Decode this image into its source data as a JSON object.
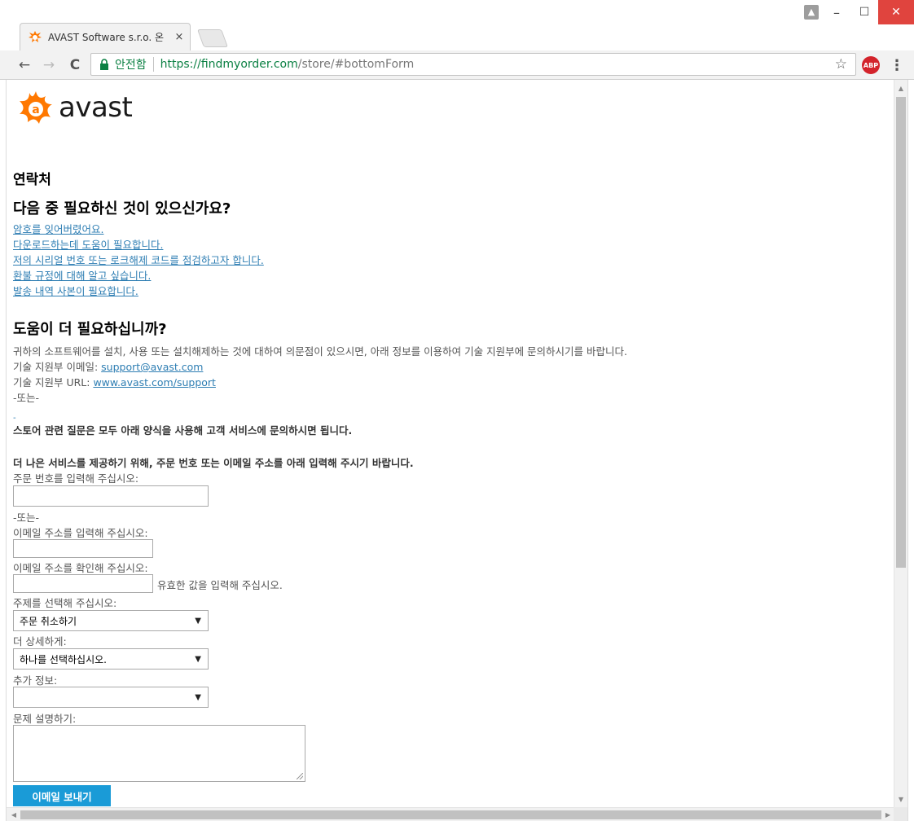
{
  "browser": {
    "tab_title": "AVAST Software s.r.o. 온",
    "tab_close": "×",
    "secure_label": "안전함",
    "url_host": "https://findmyorder.com",
    "url_path": "/store/#bottomForm",
    "star_icon": "☆",
    "abp_label": "ABP",
    "menu_icon": "⋮",
    "controls": {
      "user": "▲",
      "minimize": "–",
      "maximize": "☐",
      "close": "✕"
    },
    "nav": {
      "back": "←",
      "forward": "→",
      "reload": "C"
    }
  },
  "logo": {
    "wordmark": "avast",
    "color": "#ff7800"
  },
  "page": {
    "contact_heading": "연락처",
    "need_heading": "다음 중 필요하신 것이 있으신가요?",
    "links": [
      " 암호를 잊어버렸어요.",
      "다운로드하는데 도움이 필요합니다.",
      "저의 시리얼 번호 또는 로크해제 코드를 점검하고자 합니다.",
      "환불 규정에 대해 알고 싶습니다.",
      "발송 내역 사본이 필요합니다."
    ],
    "more_heading": "도움이 더 필요하십니까?",
    "support_text": "귀하의 소프트웨어를 설치, 사용 또는 설치해제하는 것에 대하여 의문점이 있으시면, 아래 정보를 이용하여 기술 지원부에 문의하시기를 바랍니다.",
    "email_label": "기술 지원부 이메일: ",
    "email_link": "support@avast.com",
    "url_label": "기술 지원부 URL: ",
    "url_link": "www.avast.com/support",
    "or_text": "-또는-",
    "tiny_link": "-",
    "store_note": "스토어 관련 질문은 모두 아래 양식을 사용해 고객 서비스에 문의하시면 됩니다.",
    "service_note": "더 나은 서비스를 제공하기 위해, 주문 번호 또는 이메일 주소를 아래 입력해 주시기 바랍니다."
  },
  "form": {
    "order_label": "주문 번호를 입력해 주십시오:",
    "or_text": "-또는-",
    "email_label": "이메일 주소를 입력해 주십시오:",
    "confirm_label": "이메일 주소를 확인해 주십시오:",
    "validation_msg": "유효한 값을 입력해 주십시오.",
    "topic_label": "주제를 선택해 주십시오:",
    "topic_value": "주문 취소하기",
    "detail_label": "더 상세하게:",
    "detail_value": "하나를 선택하십시오.",
    "extra_label": "추가 정보:",
    "extra_value": "",
    "describe_label": "문제 설명하기:",
    "send_button": "이메일 보내기",
    "caret": "▼"
  },
  "colors": {
    "link": "#2e7eb3",
    "button": "#1a9bd7",
    "secure": "#0b8043",
    "close": "#e0443e"
  }
}
